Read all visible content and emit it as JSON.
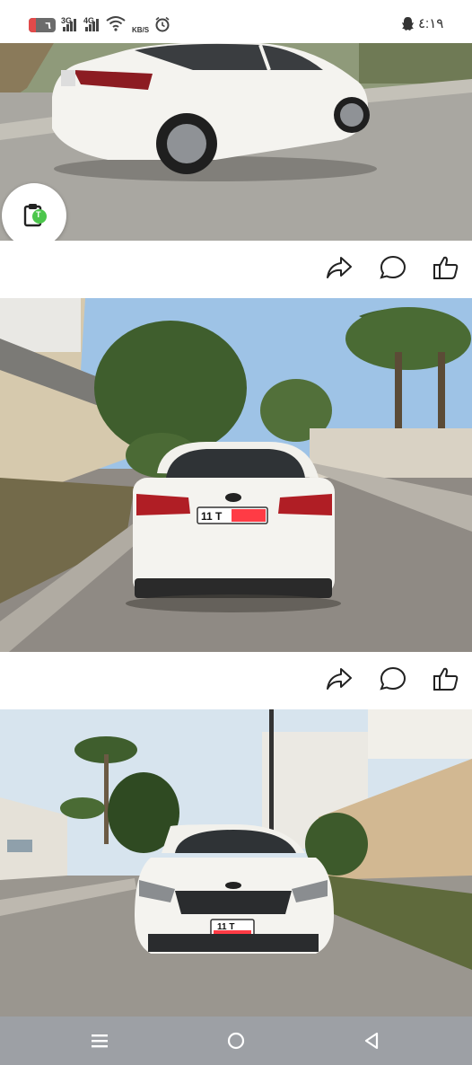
{
  "status_bar": {
    "battery_level": "٦",
    "network_1": "3G",
    "network_2": "4G",
    "speed_unit": "KB/S",
    "time": "٤:١٩",
    "icons": [
      "battery-icon",
      "signal-icon",
      "wifi-icon",
      "alarm-icon",
      "snapchat-icon"
    ]
  },
  "posts": [
    {
      "photo": "car-side-view",
      "actions": [
        "share-icon",
        "comment-icon",
        "like-icon"
      ]
    },
    {
      "photo": "car-rear-view",
      "plate_text": "11 T",
      "actions": [
        "share-icon",
        "comment-icon",
        "like-icon"
      ]
    },
    {
      "photo": "car-front-view",
      "plate_text": "11 T"
    }
  ],
  "floating_button": {
    "icon": "clipboard-icon",
    "badge": "T"
  },
  "colors": {
    "plate_highlight": "#ff3b45",
    "badge_green": "#4cc64c",
    "nav_bar": "#9da0a5"
  },
  "nav_bar": {
    "icons": [
      "recent-apps-icon",
      "home-icon",
      "back-icon"
    ]
  }
}
